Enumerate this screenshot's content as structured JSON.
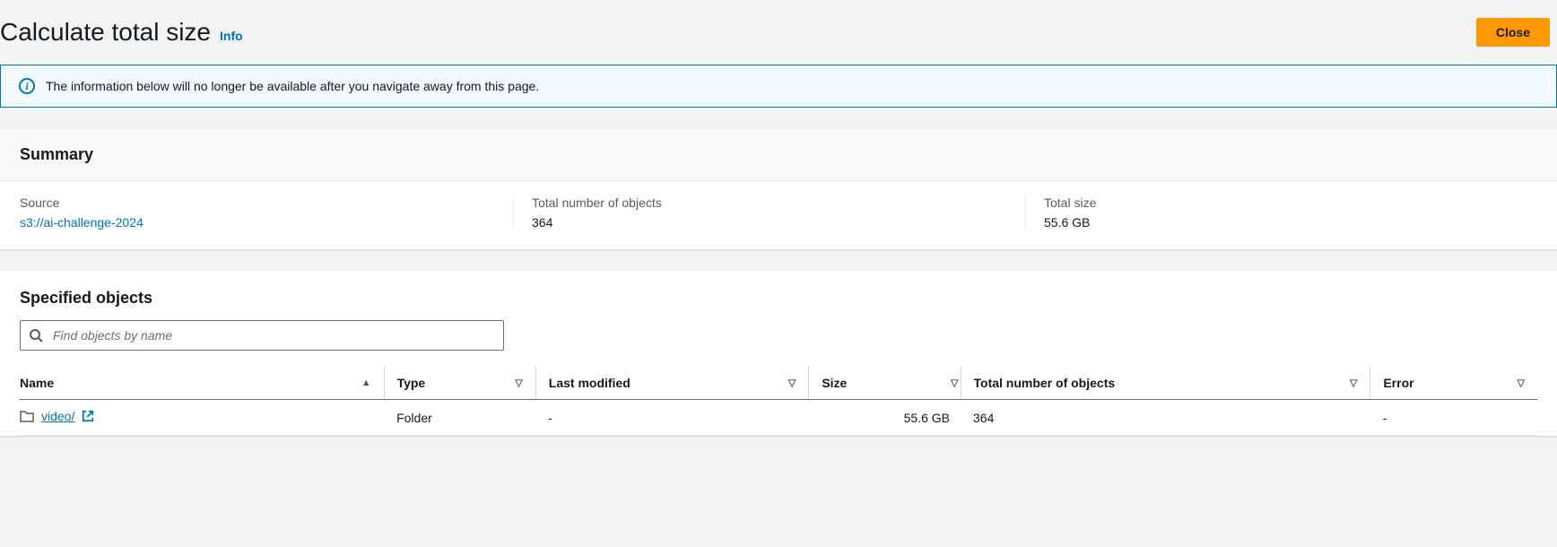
{
  "header": {
    "title": "Calculate total size",
    "info_link": "Info",
    "close_button": "Close"
  },
  "banner": {
    "text": "The information below will no longer be available after you navigate away from this page."
  },
  "summary": {
    "title": "Summary",
    "source_label": "Source",
    "source_value": "s3://ai-challenge-2024",
    "objects_label": "Total number of objects",
    "objects_value": "364",
    "size_label": "Total size",
    "size_value": "55.6 GB"
  },
  "specified": {
    "title": "Specified objects",
    "search_placeholder": "Find objects by name"
  },
  "table": {
    "columns": {
      "name": "Name",
      "type": "Type",
      "last_modified": "Last modified",
      "size": "Size",
      "total_objects": "Total number of objects",
      "error": "Error"
    },
    "rows": [
      {
        "name": "video/",
        "type": "Folder",
        "last_modified": "-",
        "size": "55.6 GB",
        "total_objects": "364",
        "error": "-"
      }
    ]
  }
}
